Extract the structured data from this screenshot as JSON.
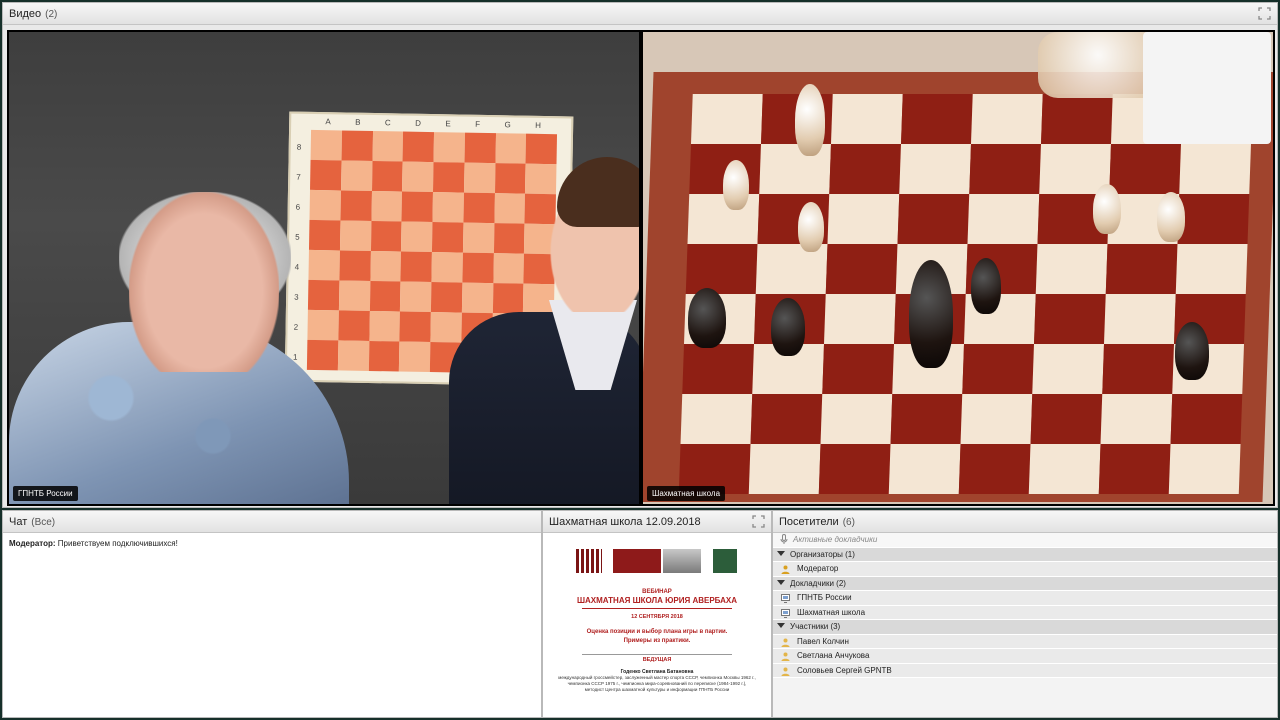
{
  "video_pod": {
    "title": "Видео",
    "count": "(2)",
    "feeds": [
      {
        "label": "ГПНТБ России"
      },
      {
        "label": "Шахматная школа"
      }
    ],
    "wallboard_files": [
      "A",
      "B",
      "C",
      "D",
      "E",
      "F",
      "G",
      "H"
    ],
    "wallboard_ranks": [
      "8",
      "7",
      "6",
      "5",
      "4",
      "3",
      "2",
      "1"
    ]
  },
  "chat_pod": {
    "title": "Чат",
    "scope": "(Все)",
    "messages": [
      {
        "author": "Модератор:",
        "text": "Приветствуем подключившихся!"
      }
    ]
  },
  "share_pod": {
    "title": "Шахматная школа 12.09.2018",
    "slide": {
      "subtitle": "ВЕБИНАР",
      "title": "ШАХМАТНАЯ ШКОЛА ЮРИЯ АВЕРБАХА",
      "date": "12 СЕНТЯБРЯ 2018",
      "topic_line1": "Оценка позиции и выбор плана игры в партии.",
      "topic_line2": "Примеры из практики.",
      "lead_label": "ВЕДУЩАЯ",
      "lead_name": "Годенко Светлана Батановна",
      "bio_line1": "международный гроссмейстер, заслуженный мастер спорта СССР, чемпионка Москвы 1962 г.,",
      "bio_line2": "чемпионка СССР 1975 г., чемпионка мира-соревнований по переписке (1984-1992 г.),",
      "bio_line3": "методист Центра шахматной культуры и информации ГПНТБ России"
    }
  },
  "attendees_pod": {
    "title": "Посетители",
    "count": "(6)",
    "active_speakers": "Активные докладчики",
    "sections": [
      {
        "label": "Организаторы (1)",
        "members": [
          "Модератор"
        ]
      },
      {
        "label": "Докладчики (2)",
        "members": [
          "ГПНТБ России",
          "Шахматная школа"
        ]
      },
      {
        "label": "Участники (3)",
        "members": [
          "Павел Колчин",
          "Светлана Анчукова",
          "Соловьев Сергей GPNTB"
        ]
      }
    ]
  },
  "colors": {
    "frame": "#16302a",
    "pod_bg": "#e9e9e9",
    "slide_red": "#b02020"
  }
}
